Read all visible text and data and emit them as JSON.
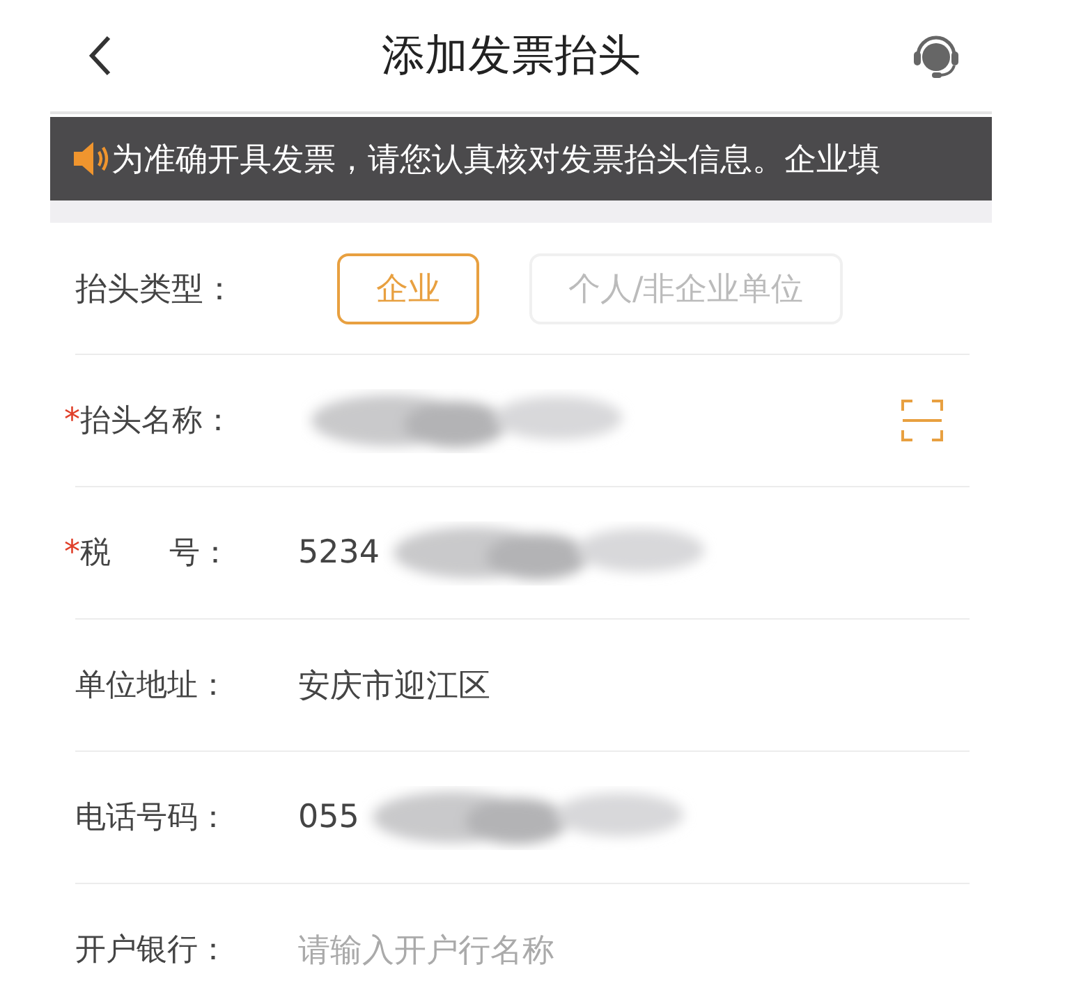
{
  "header": {
    "title": "添加发票抬头"
  },
  "notice": {
    "text": "为准确开具发票，请您认真核对发票抬头信息。企业填"
  },
  "title_type": {
    "label": "抬头类型：",
    "options": [
      {
        "label": "企业",
        "selected": true
      },
      {
        "label": "个人/非企业单位",
        "selected": false
      }
    ]
  },
  "fields": [
    {
      "required_mark": "*",
      "label": "抬头名称：",
      "redacted": true,
      "scan_button": true
    },
    {
      "required_mark": "*",
      "label": "税      号：",
      "value": "5234",
      "redacted": true
    },
    {
      "label": "单位地址：",
      "value": "安庆市迎江区"
    },
    {
      "label": "电话号码：",
      "value": "055",
      "redacted": true
    },
    {
      "label": "开户银行：",
      "placeholder": "请输入开户行名称"
    }
  ]
}
